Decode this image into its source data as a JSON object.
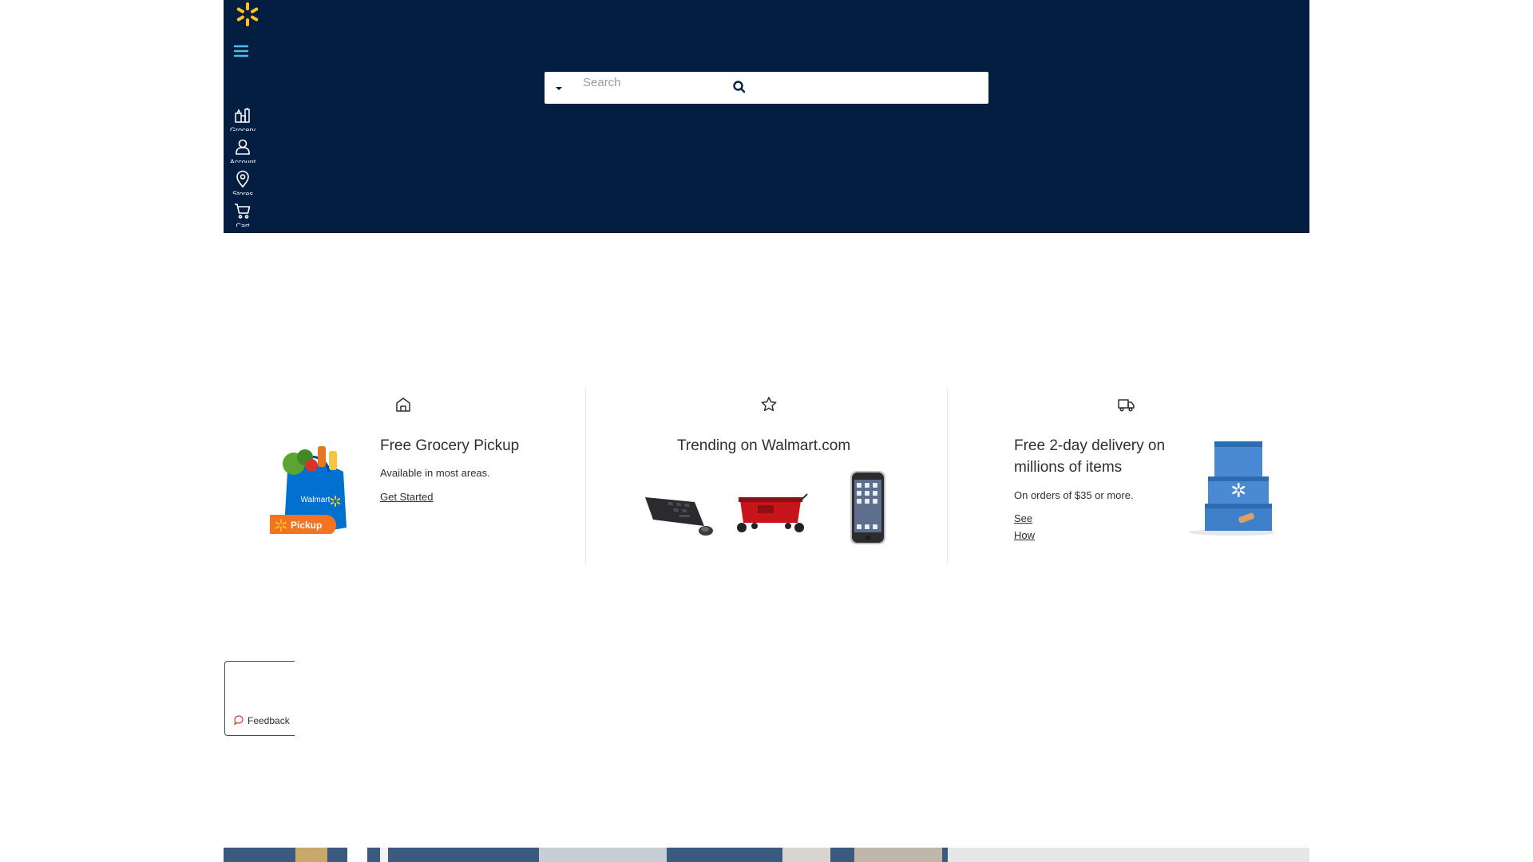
{
  "header": {
    "logo_icon": "spark-logo-icon",
    "menu_icon": "hamburger-menu-icon",
    "nav": [
      {
        "label": "Grocery",
        "icon": "grocery-icon"
      },
      {
        "label": "Account",
        "icon": "account-icon"
      },
      {
        "label": "Stores",
        "icon": "location-pin-icon"
      },
      {
        "label": "Cart",
        "icon": "cart-icon"
      }
    ],
    "search": {
      "placeholder": "Search",
      "value": "",
      "department_icon": "caret-down-icon",
      "submit_icon": "search-icon"
    },
    "colors": {
      "header_bg": "#041e42",
      "spark": "#ffc220",
      "menu": "#4dbdeb"
    }
  },
  "value_props": [
    {
      "icon": "house-icon",
      "accent": "#42b3d6",
      "title": "Free Grocery Pickup",
      "subtitle": "Available in most areas.",
      "link": "Get Started",
      "image_badge": "Pickup",
      "image_bag_text": "Walmart"
    },
    {
      "icon": "star-icon",
      "accent": "#42b3d6",
      "title": "Trending on Walmart.com",
      "products": [
        "keyboard-and-mouse",
        "red-wagon",
        "smartphone"
      ]
    },
    {
      "icon": "delivery-truck-icon",
      "accent": "#f5b920",
      "title": "Free 2-day delivery on millions of items",
      "subtitle": "On orders of $35 or more.",
      "link": "See How"
    }
  ],
  "feedback": {
    "label": "Feedback",
    "icon": "chat-bubble-icon"
  }
}
